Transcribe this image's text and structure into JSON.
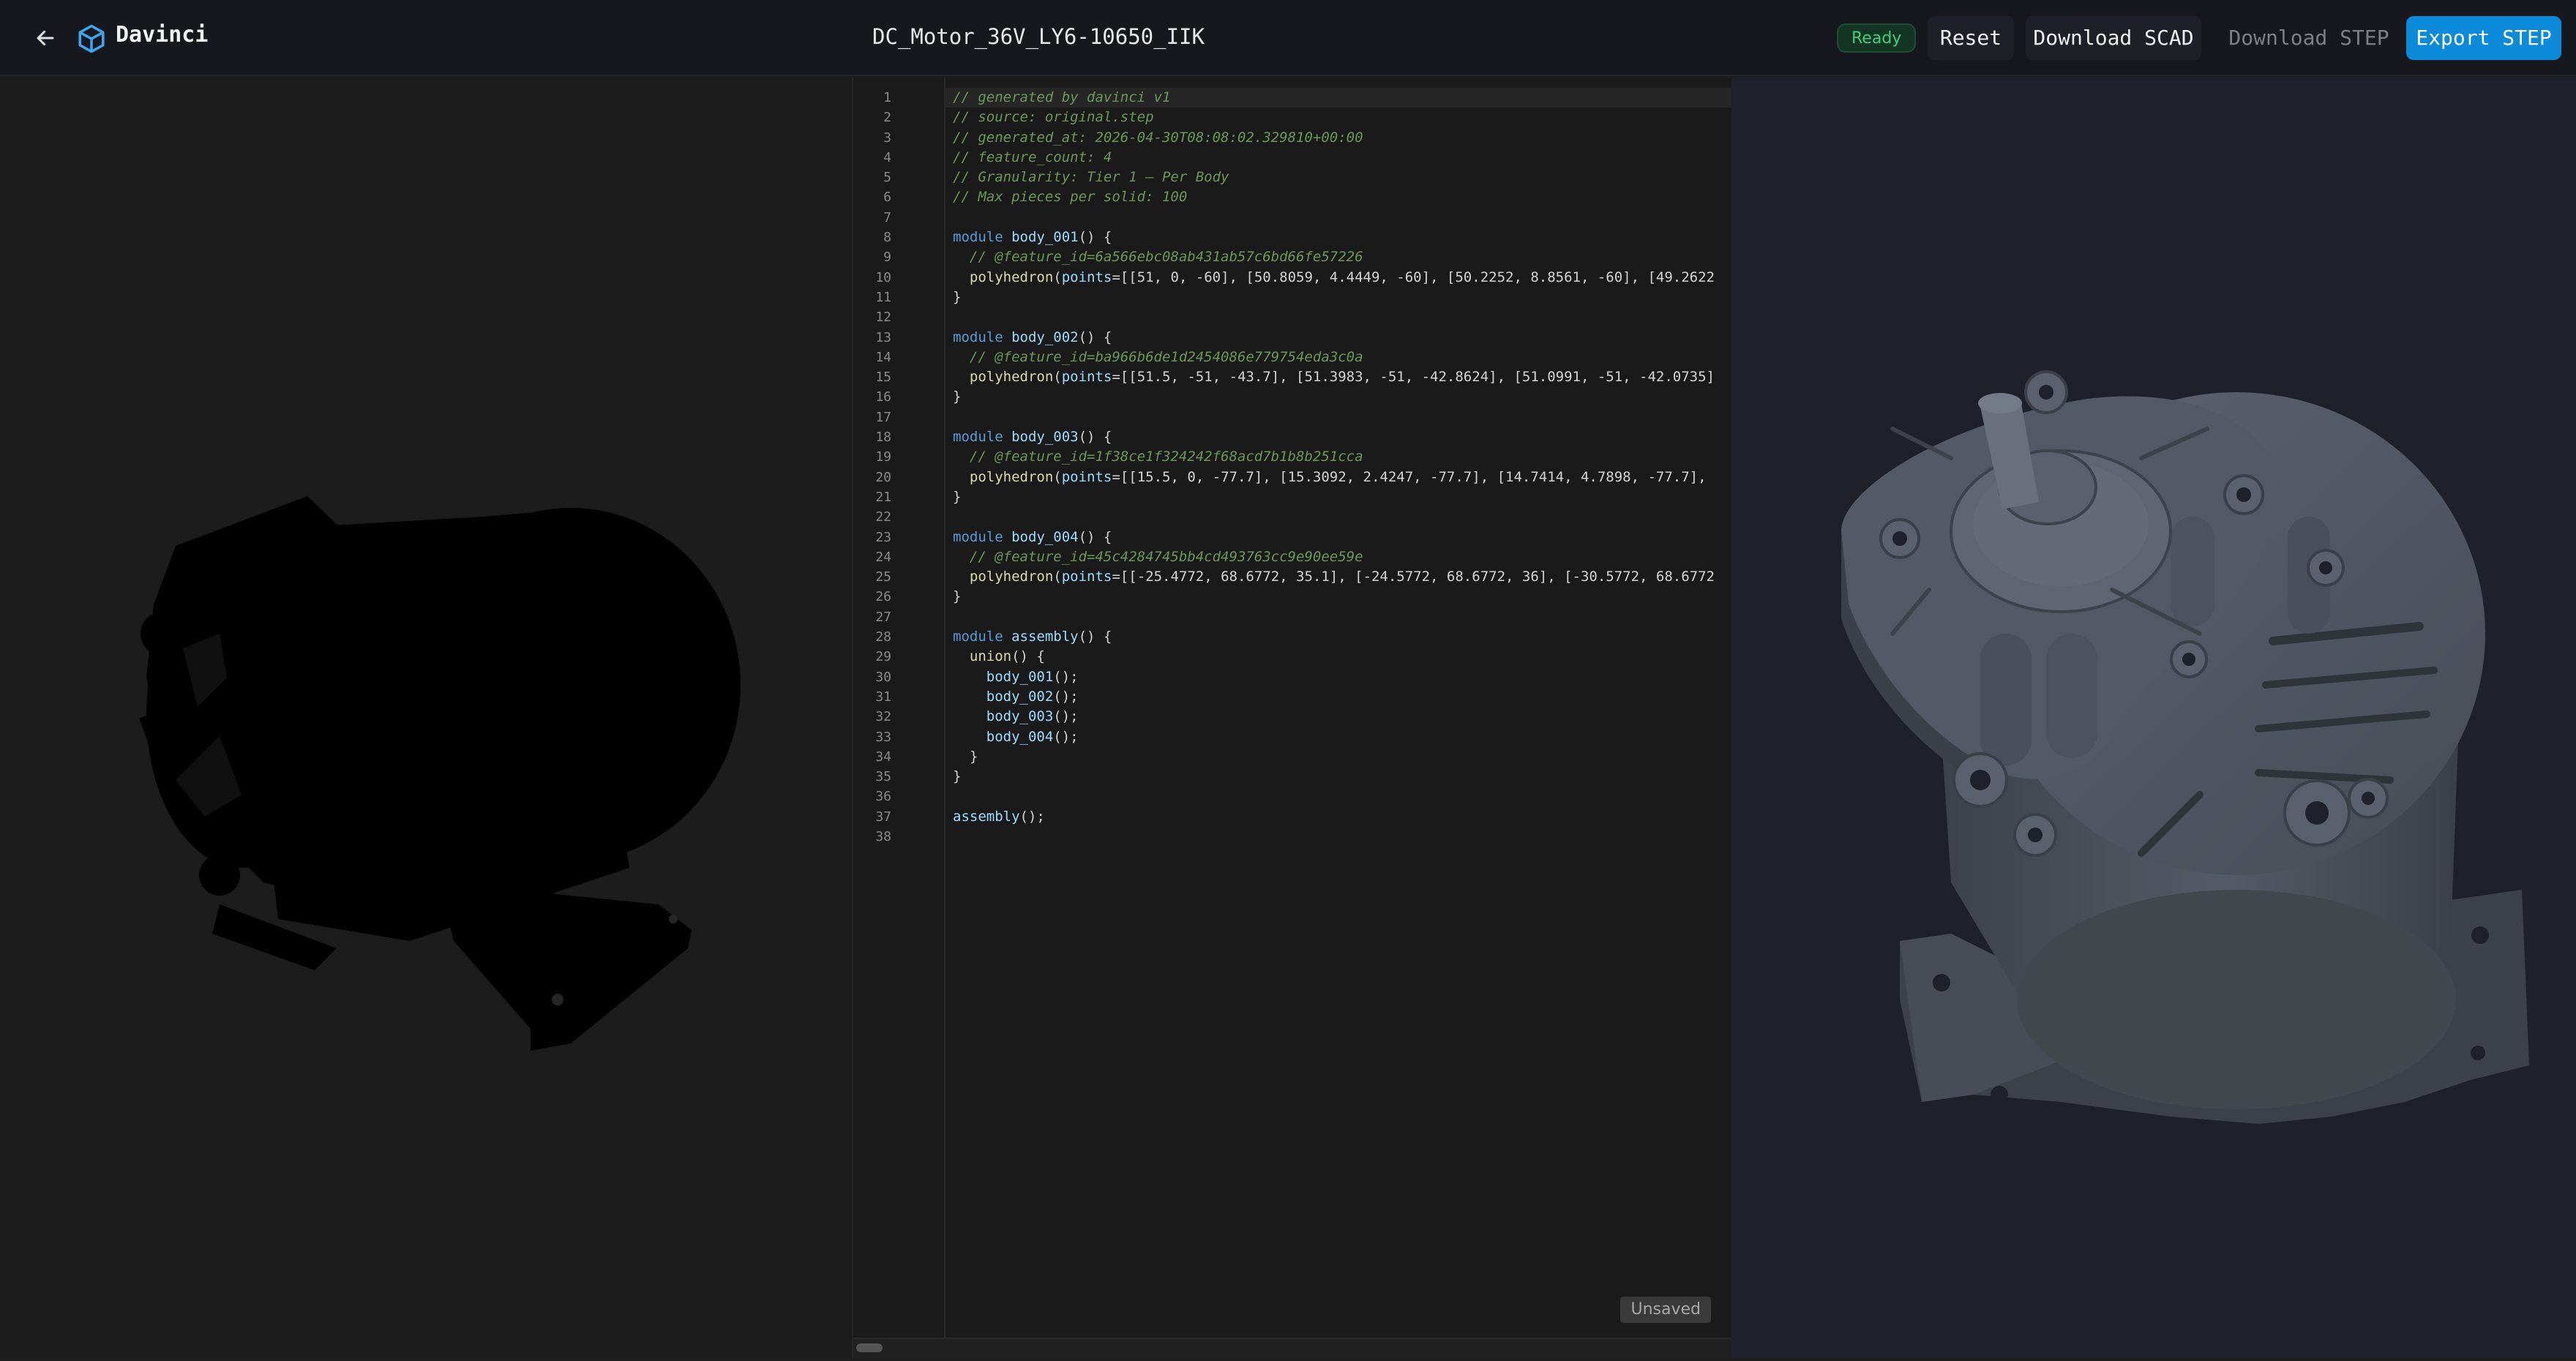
{
  "header": {
    "app_title": "Davinci",
    "doc_title": "DC_Motor_36V_LY6-10650_IIK",
    "status": "Ready",
    "reset_label": "Reset",
    "download_scad_label": "Download SCAD",
    "download_step_label": "Download STEP",
    "export_step_label": "Export STEP",
    "icons": {
      "back": "arrow-left-icon",
      "logo": "cube-icon"
    }
  },
  "editor": {
    "unsaved_label": "Unsaved",
    "lines": [
      "// generated by davinci v1",
      "// source: original.step",
      "// generated_at: 2026-04-30T08:08:02.329810+00:00",
      "// feature_count: 4",
      "// Granularity: Tier 1 — Per Body",
      "// Max pieces per solid: 100",
      "",
      "module body_001() {",
      "  // @feature_id=6a566ebc08ab431ab57c6bd66fe57226",
      "  polyhedron(points=[[51, 0, -60], [50.8059, 4.4449, -60], [50.2252, 8.8561, -60], [49.2622",
      "}",
      "",
      "module body_002() {",
      "  // @feature_id=ba966b6de1d2454086e779754eda3c0a",
      "  polyhedron(points=[[51.5, -51, -43.7], [51.3983, -51, -42.8624], [51.0991, -51, -42.0735]",
      "}",
      "",
      "module body_003() {",
      "  // @feature_id=1f38ce1f324242f68acd7b1b8b251cca",
      "  polyhedron(points=[[15.5, 0, -77.7], [15.3092, 2.4247, -77.7], [14.7414, 4.7898, -77.7],",
      "}",
      "",
      "module body_004() {",
      "  // @feature_id=45c4284745bb4cd493763cc9e90ee59e",
      "  polyhedron(points=[[-25.4772, 68.6772, 35.1], [-24.5772, 68.6772, 36], [-30.5772, 68.6772",
      "}",
      "",
      "module assembly() {",
      "  union() {",
      "    body_001();",
      "    body_002();",
      "    body_003();",
      "    body_004();",
      "  }",
      "}",
      "",
      "assembly();",
      ""
    ]
  },
  "colors": {
    "accent": "#0a8ad8",
    "status_ready": "#3ccf83",
    "model_right": "#4a4f5a",
    "model_left": "#000000"
  }
}
